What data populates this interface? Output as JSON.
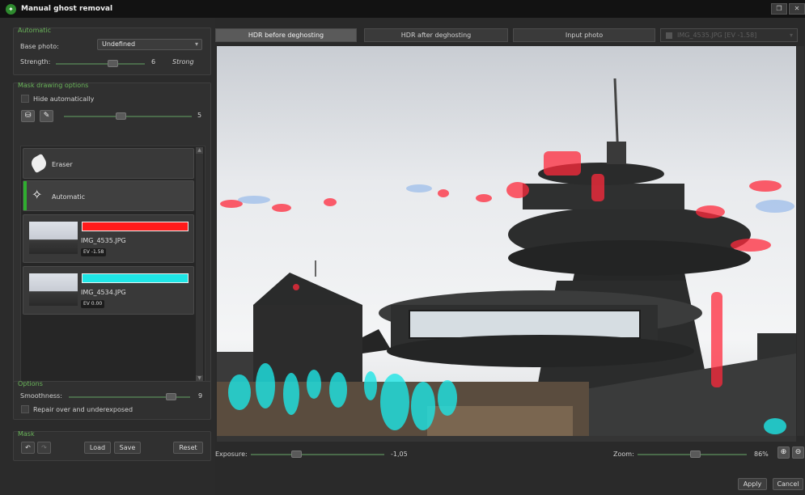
{
  "window": {
    "title": "Manual ghost removal",
    "logo": "app-logo",
    "restore_icon": "❐",
    "close_icon": "✕"
  },
  "automatic": {
    "group_title": "Automatic",
    "base_photo_label": "Base photo:",
    "base_photo_value": "Undefined",
    "strength_label": "Strength:",
    "strength_value": "6",
    "strength_level": 0.6,
    "strength_max_label": "Strong"
  },
  "mask_drawing": {
    "group_title": "Mask drawing options",
    "hide_auto_label": "Hide automatically",
    "hide_auto_checked": false,
    "brush_size_value": "5",
    "brush_size_level": 0.45,
    "tools": [
      {
        "label": "Eraser",
        "icon": "eraser-icon"
      },
      {
        "label": "Automatic",
        "icon": "magic-wand-icon",
        "active": true
      }
    ],
    "layers": [
      {
        "filename": "IMG_4535.JPG",
        "ev": "EV -1.58",
        "color": "#ff1a1a"
      },
      {
        "filename": "IMG_4534.JPG",
        "ev": "EV 0.00",
        "color": "#1ee6e6"
      }
    ]
  },
  "options": {
    "group_title": "Options",
    "smoothness_label": "Smoothness:",
    "smoothness_value": "9",
    "smoothness_level": 0.9,
    "repair_label": "Repair over and underexposed",
    "repair_checked": false
  },
  "mask": {
    "group_title": "Mask",
    "load_label": "Load",
    "save_label": "Save",
    "reset_label": "Reset"
  },
  "tabs": [
    {
      "label": "HDR before deghosting",
      "active": true
    },
    {
      "label": "HDR after deghosting"
    },
    {
      "label": "Input photo"
    },
    {
      "label": "IMG_4535.JPG [EV -1.58]",
      "disabled": true
    }
  ],
  "bottom": {
    "exposure_label": "Exposure:",
    "exposure_value": "-1,05",
    "exposure_level": 0.3,
    "zoom_label": "Zoom:",
    "zoom_value": "86%",
    "zoom_level": 0.45
  },
  "actions": {
    "apply_label": "Apply",
    "cancel_label": "Cancel"
  },
  "colors": {
    "accent_green": "#2fae2f",
    "group_title_green": "#6ab55a"
  }
}
